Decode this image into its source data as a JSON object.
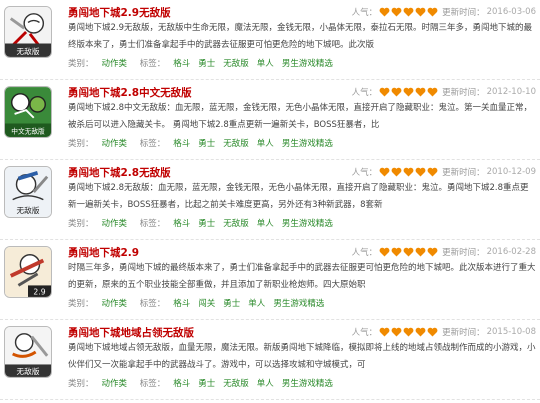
{
  "labels": {
    "popularity": "人气：",
    "updated": "更新时间：",
    "category": "类别：",
    "tags": "标签："
  },
  "items": [
    {
      "title": "勇闯地下城2.9无敌版",
      "icon_caption": "无敌版",
      "date": "2016-03-06",
      "rating": 5,
      "desc": "勇闯地下城2.9无敌版，无敌版中生命无限，魔法无限，金钱无限，小晶体无限，泰拉石无限。时隔三年多，勇闯地下城的最终版本来了，勇士们准备拿起手中的武器去征服更可怕更危险的地下城吧。此次版",
      "category": "动作类",
      "tags": [
        "格斗",
        "勇士",
        "无敌版",
        "单人",
        "男生游戏精选"
      ]
    },
    {
      "title": "勇闯地下城2.8中文无敌版",
      "icon_caption": "中文无敌版",
      "date": "2012-10-10",
      "rating": 5,
      "desc": "勇闯地下城2.8中文无敌版：血无限，蓝无限，金钱无限，无色小晶体无限，直接开启了隐藏职业：鬼泣。第一关血量正常，被杀后可以进入隐藏关卡。 勇闯地下城2.8重点更新一遍新关卡，BOSS狂暴者，比",
      "category": "动作类",
      "tags": [
        "格斗",
        "勇士",
        "无敌版",
        "单人",
        "男生游戏精选"
      ]
    },
    {
      "title": "勇闯地下城2.8无敌版",
      "icon_caption": "无敌版",
      "date": "2010-12-09",
      "rating": 5,
      "desc": "勇闯地下城2.8无敌版：血无限，蓝无限，金钱无限，无色小晶体无限，直接开启了隐藏职业：鬼泣。勇闯地下城2.8重点更新一遍新关卡，BOSS狂暴者，比起之前关卡难度更高，另外还有3种新武器，8套新",
      "category": "动作类",
      "tags": [
        "格斗",
        "勇士",
        "无敌版",
        "单人",
        "男生游戏精选"
      ]
    },
    {
      "title": "勇闯地下城2.9",
      "icon_caption": "2.9",
      "date": "2016-02-28",
      "rating": 5,
      "desc": "时隔三年多，勇闯地下城的最终版本来了，勇士们准备拿起手中的武器去征服更可怕更危险的地下城吧。此次版本进行了重大的更新，原来的五个职业技能全部重做，并且添加了新职业枪炮师。四大原始职",
      "category": "动作类",
      "tags": [
        "格斗",
        "闯关",
        "勇士",
        "单人",
        "男生游戏精选"
      ]
    },
    {
      "title": "勇闯地下城地域占领无敌版",
      "icon_caption": "无敌版",
      "date": "2015-10-08",
      "rating": 5,
      "desc": "勇闯地下城地域占领无敌版，血量无限，魔法无限。新版勇闯地下城降临，模拟即将上线的地域占领战制作而成的小游戏，小伙伴们又一次能拿起手中的武器战斗了。游戏中，可以选择攻城和守城模式，可",
      "category": "动作类",
      "tags": [
        "格斗",
        "勇士",
        "无敌版",
        "单人",
        "男生游戏精选"
      ]
    }
  ]
}
